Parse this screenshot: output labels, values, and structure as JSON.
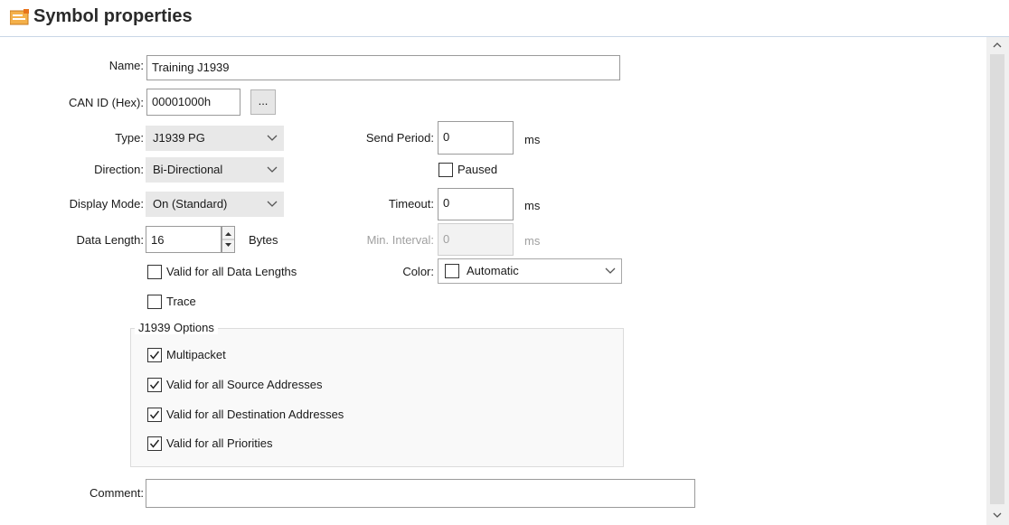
{
  "header": {
    "title": "Symbol properties",
    "icon": "symbol-properties-icon"
  },
  "form": {
    "name": {
      "label": "Name:",
      "value": "Training J1939"
    },
    "can_id": {
      "label": "CAN ID (Hex):",
      "value": "00001000h",
      "button": "..."
    },
    "type": {
      "label": "Type:",
      "value": "J1939 PG"
    },
    "direction": {
      "label": "Direction:",
      "value": "Bi-Directional"
    },
    "display_mode": {
      "label": "Display Mode:",
      "value": "On (Standard)"
    },
    "data_length": {
      "label": "Data Length:",
      "value": "16",
      "unit": "Bytes"
    },
    "valid_all_lengths": {
      "label": "Valid for all Data Lengths",
      "checked": false
    },
    "trace": {
      "label": "Trace",
      "checked": false
    },
    "send_period": {
      "label": "Send Period:",
      "value": "0",
      "unit": "ms"
    },
    "paused": {
      "label": "Paused",
      "checked": false
    },
    "timeout": {
      "label": "Timeout:",
      "value": "0",
      "unit": "ms"
    },
    "min_interval": {
      "label": "Min. Interval:",
      "value": "0",
      "unit": "ms",
      "enabled": false
    },
    "color": {
      "label": "Color:",
      "value": "Automatic"
    },
    "comment": {
      "label": "Comment:",
      "value": ""
    }
  },
  "j1939_options": {
    "title": "J1939 Options",
    "options": [
      {
        "label": "Multipacket",
        "checked": true
      },
      {
        "label": "Valid for all Source Addresses",
        "checked": true
      },
      {
        "label": "Valid for all Destination Addresses",
        "checked": true
      },
      {
        "label": "Valid for all Priorities",
        "checked": true
      }
    ]
  },
  "colors": {
    "header_border": "#c9d6e6",
    "combo_bg": "#e8e8e8",
    "icon_orange": "#e8731a"
  }
}
